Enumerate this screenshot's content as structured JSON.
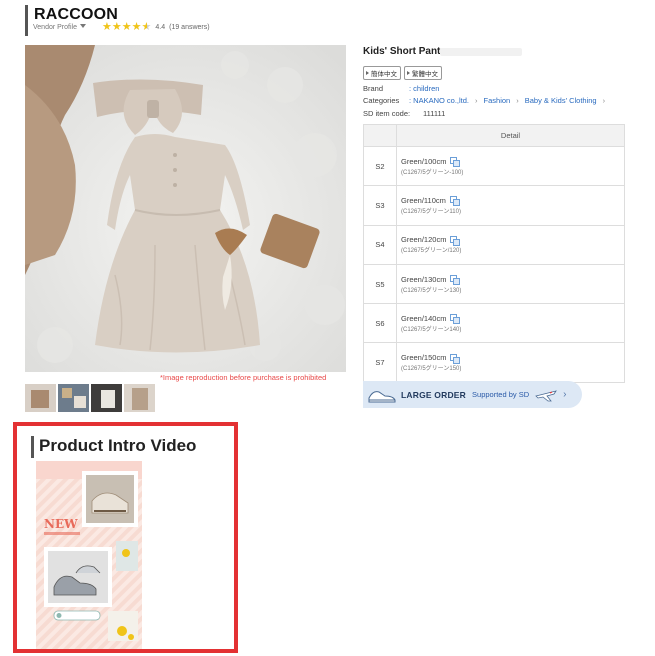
{
  "vendor": {
    "name": "RACCOON",
    "profile_label": "Vendor Profile",
    "rating": "4.4",
    "answers": "(19 answers)"
  },
  "product": {
    "title": "Kids' Short Pant",
    "lang_buttons": [
      "簡体中文",
      "繁體中文"
    ],
    "brand_label": "Brand",
    "brand_value": ": children",
    "categories_label": "Categories",
    "categories": [
      ": NAKANO co.,ltd.",
      "Fashion",
      "Baby & Kids' Clothing"
    ],
    "sd_code_label": "SD item code:",
    "sd_code_value": "111111",
    "image_notice": "*Image reproduction before purchase is prohibited"
  },
  "options_table": {
    "header_detail": "Detail",
    "rows": [
      {
        "code": "S2",
        "name": "Green/100cm",
        "sub": "(C1267/5グリーン-100)"
      },
      {
        "code": "S3",
        "name": "Green/110cm",
        "sub": "(C1267/5グリーン110)"
      },
      {
        "code": "S4",
        "name": "Green/120cm",
        "sub": "(C12675グリーン/120)"
      },
      {
        "code": "S5",
        "name": "Green/130cm",
        "sub": "(C1267/5グリーン130)"
      },
      {
        "code": "S6",
        "name": "Green/140cm",
        "sub": "(C1267/5グリーン140)"
      },
      {
        "code": "S7",
        "name": "Green/150cm",
        "sub": "(C1267/5グリーン150)"
      }
    ]
  },
  "large_order": {
    "label": "LARGE ORDER",
    "sub": "Supported by SD",
    "chevron": "›"
  },
  "video": {
    "title": "Product Intro Video",
    "new_badge": "NEW"
  },
  "colors": {
    "accent_red": "#e33133",
    "link_blue": "#2a6bbf",
    "star_gold": "#f0c419"
  }
}
